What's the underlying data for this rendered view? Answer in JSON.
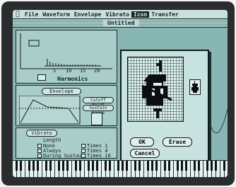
{
  "menu": {
    "items": [
      "File",
      "Waveform",
      "Envelope",
      "Vibrato",
      "Icon",
      "Transfer"
    ],
    "selected_index": 4
  },
  "window": {
    "title": "Untitled"
  },
  "harmonics": {
    "label": "Harmonics",
    "ticks": [
      "5",
      "10",
      "15",
      "20"
    ]
  },
  "envelope": {
    "label": "Envelope",
    "cutoff_button": "Cutoff Point",
    "sustain_button": "Sustain Range"
  },
  "vibrato": {
    "label": "Vibrato",
    "length_label": "Length",
    "options_left": [
      "None",
      "Always",
      "During Sustain"
    ],
    "options_right": [
      "Times 1",
      "Times 4",
      "Times 16"
    ]
  },
  "icon_dialog": {
    "ok_label": "OK",
    "erase_label": "Erase",
    "cancel_label": "Cancel"
  },
  "icons": {
    "menu_apple": "apple-icon",
    "instrument": "cello-icon"
  }
}
